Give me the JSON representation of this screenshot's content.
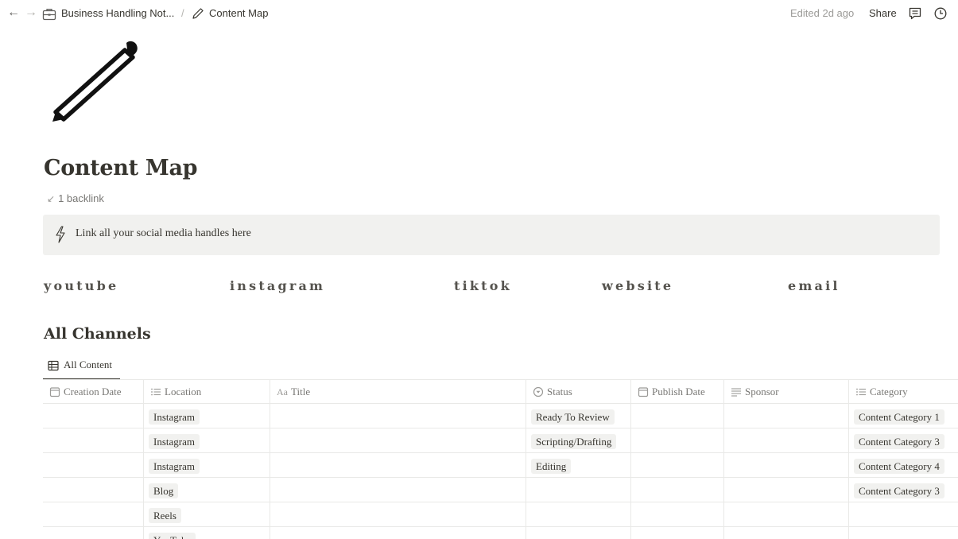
{
  "topbar": {
    "back_icon": "arrow-left-icon",
    "forward_icon": "arrow-right-icon",
    "breadcrumb": [
      {
        "icon": "briefcase-icon",
        "label": "Business Handling Not..."
      },
      {
        "icon": "pencil-icon",
        "label": "Content Map"
      }
    ],
    "separator": "/",
    "edited": "Edited 2d ago",
    "share_label": "Share",
    "comments_icon": "comment-icon",
    "updates_icon": "clock-icon"
  },
  "page": {
    "icon": "pencil-icon",
    "title": "Content Map",
    "backlink": "1 backlink"
  },
  "callout": {
    "icon": "lightning-icon",
    "text": "Link all your social media handles here"
  },
  "handles": [
    "youtube",
    "instagram",
    "tiktok",
    "website",
    "email"
  ],
  "section": {
    "heading": "All Channels",
    "view_tab": {
      "icon": "table-icon",
      "label": "All Content"
    }
  },
  "table": {
    "columns": [
      {
        "icon": "calendar-icon",
        "label": "Creation Date"
      },
      {
        "icon": "list-icon",
        "label": "Location"
      },
      {
        "icon": "title-icon",
        "prefix": "Aa",
        "label": "Title"
      },
      {
        "icon": "status-icon",
        "label": "Status"
      },
      {
        "icon": "calendar-icon",
        "label": "Publish Date"
      },
      {
        "icon": "text-icon",
        "label": "Sponsor"
      },
      {
        "icon": "list-icon",
        "label": "Category"
      }
    ],
    "rows": [
      {
        "location": "Instagram",
        "title": "",
        "status": "Ready To Review",
        "category": "Content Category 1"
      },
      {
        "location": "Instagram",
        "title": "",
        "status": "Scripting/Drafting",
        "category": "Content Category 3"
      },
      {
        "location": "Instagram",
        "title": "",
        "status": "Editing",
        "category": "Content Category 4"
      },
      {
        "location": "Blog",
        "title": "",
        "status": "",
        "category": "Content Category 3"
      },
      {
        "location": "Reels",
        "title": "",
        "status": "",
        "category": ""
      },
      {
        "location": "YouTube",
        "title": "",
        "status": "",
        "category": ""
      }
    ]
  }
}
